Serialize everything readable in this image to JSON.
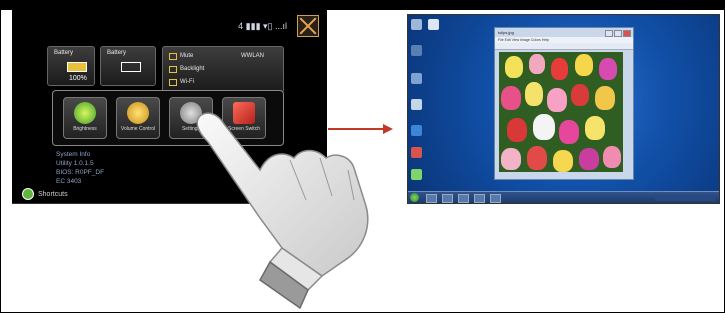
{
  "device": {
    "status_text": "4 ▮▮▮  ▾▯ ...ıl",
    "battery1_label": "Battery",
    "battery1_pct": "100%",
    "battery2_label": "Battery",
    "settings": [
      "Mute",
      "Backlight",
      "Wi-Fi"
    ],
    "settings_right": "WWLAN",
    "apps": [
      "Brightness",
      "Volume Control",
      "Settings",
      "Screen Switch"
    ],
    "info_lines": [
      "System Info",
      "Utility 1.0.1.5",
      "BIOS: R0PF_DF",
      "EC 3403"
    ],
    "shortcut_label": "Shortcuts"
  },
  "desktop": {
    "window_title": "tulips.jpg",
    "menu": "File  Edit  View  Image  Colors  Help"
  },
  "colors": {
    "arrow": "#c0392b",
    "accent": "#e3a552"
  }
}
